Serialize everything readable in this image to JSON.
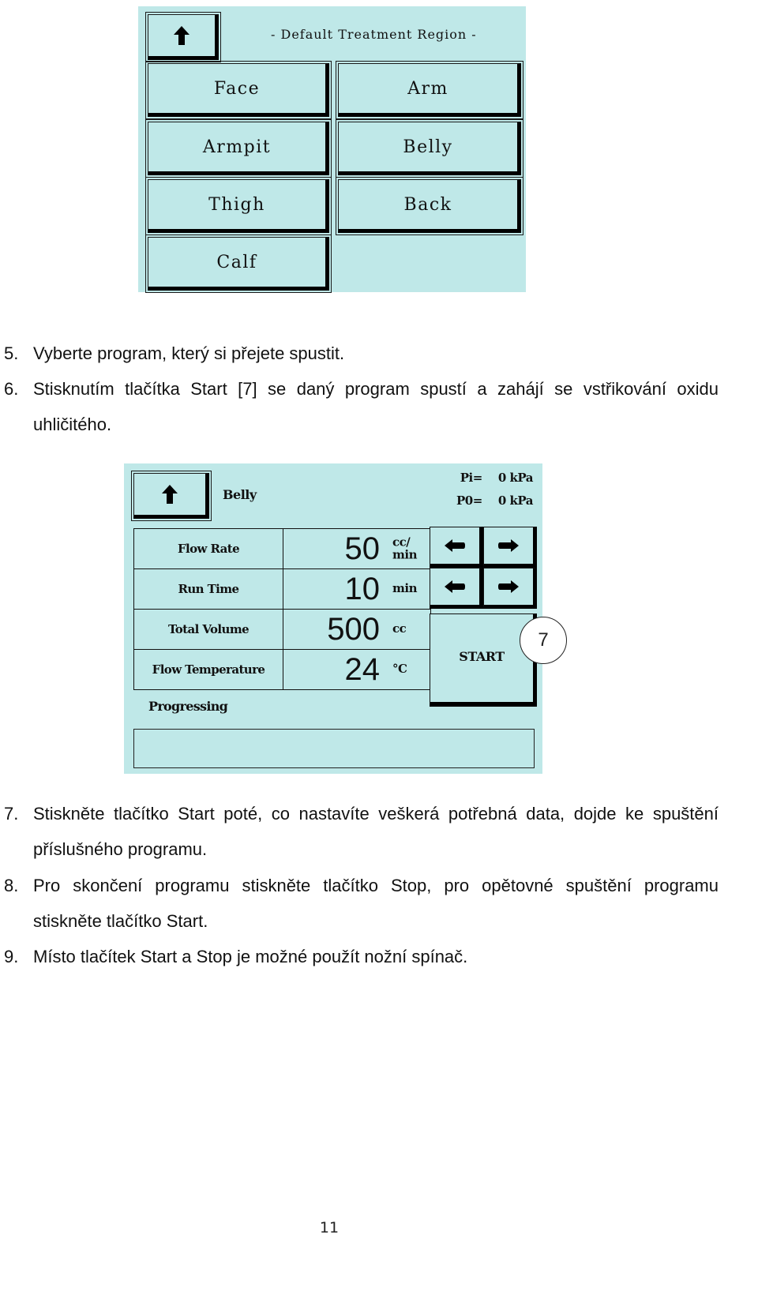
{
  "screen1": {
    "title": "- Default Treatment Region -",
    "back_icon": "up-arrow-icon",
    "regions": [
      "Face",
      "Arm",
      "Armpit",
      "Belly",
      "Thigh",
      "Back",
      "Calf"
    ]
  },
  "steps_a": [
    {
      "num": "5.",
      "text": "Vyberte program, který si přejete spustit."
    },
    {
      "num": "6.",
      "text": "Stisknutím tlačítka Start [7] se daný program spustí a zahájí se vstřikování oxidu uhličitého."
    }
  ],
  "screen2": {
    "back_icon": "up-arrow-icon",
    "region": "Belly",
    "pressure": [
      {
        "label": "Pi=",
        "value": "0",
        "unit": "kPa"
      },
      {
        "label": "P0=",
        "value": "0",
        "unit": "kPa"
      }
    ],
    "params": [
      {
        "label": "Flow Rate",
        "value": "50",
        "unit": "cc/ min"
      },
      {
        "label": "Run Time",
        "value": "10",
        "unit": "min"
      },
      {
        "label": "Total Volume",
        "value": "500",
        "unit": "cc"
      },
      {
        "label": "Flow Temperature",
        "value": "24",
        "unit": "°C"
      }
    ],
    "arrows": [
      "left-arrow-icon",
      "right-arrow-icon"
    ],
    "start_label": "START",
    "callout": "7",
    "progress_label": "Progressing",
    "progress_percent": 0
  },
  "steps_b": [
    {
      "num": "7.",
      "text": "Stiskněte tlačítko Start poté, co nastavíte veškerá potřebná data, dojde ke spuštění příslušného programu."
    },
    {
      "num": "8.",
      "text": "Pro skončení programu stiskněte tlačítko Stop, pro opětovné spuštění programu stiskněte tlačítko Start."
    },
    {
      "num": "9.",
      "text": "Místo tlačítek Start a Stop je možné použít nožní spínač."
    }
  ],
  "page_number": "11"
}
